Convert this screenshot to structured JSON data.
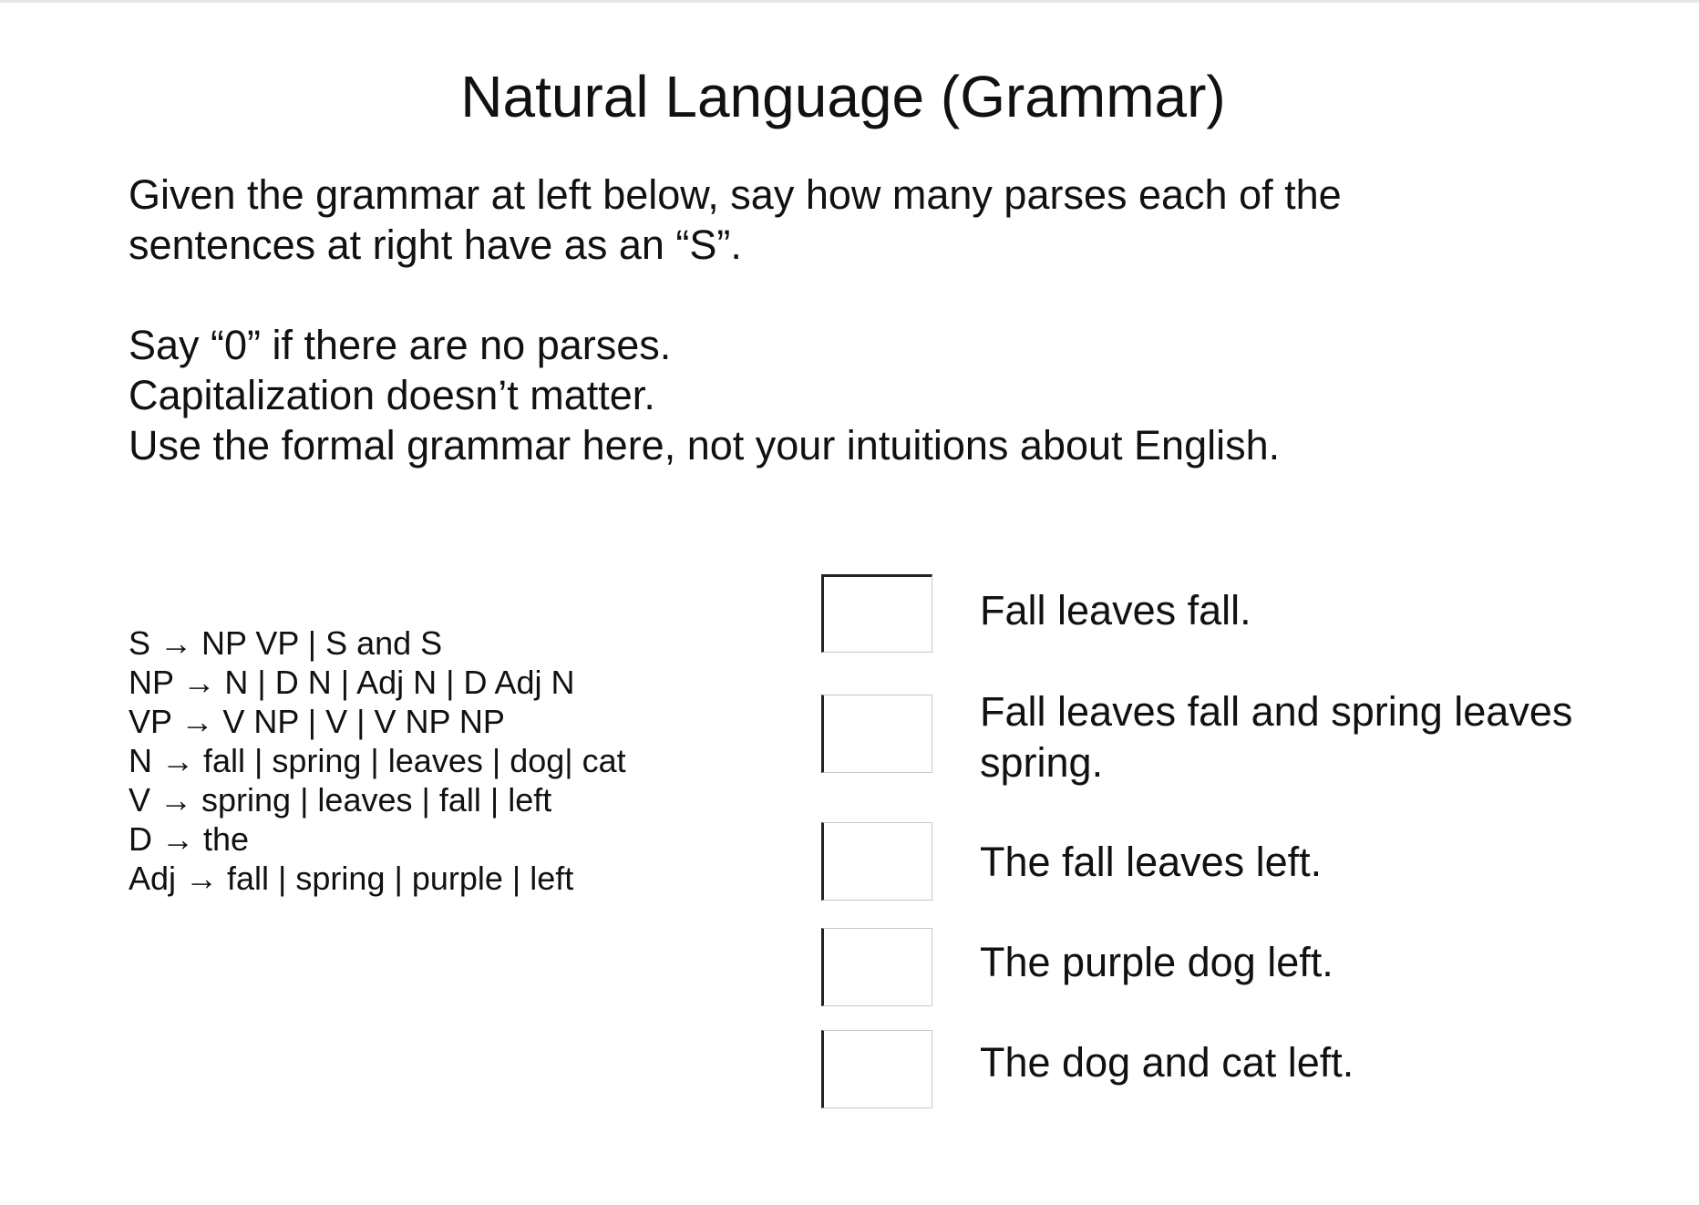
{
  "title": "Natural Language (Grammar)",
  "instructions": [
    "Given the grammar at left below, say how many parses each of the",
    "sentences at right have as an “S”.",
    "Say “0” if there are no parses.",
    "Capitalization doesn’t matter.",
    "Use the formal grammar here, not your intuitions about English."
  ],
  "grammar": [
    "S → NP VP | S and S",
    "NP → N | D N | Adj N | D Adj N",
    "VP → V NP | V | V NP NP",
    "N → fall | spring | leaves | dog| cat",
    "V → spring | leaves | fall | left",
    "D → the",
    "Adj → fall | spring | purple | left"
  ],
  "questions": [
    {
      "sentence": "Fall leaves fall.",
      "answer": ""
    },
    {
      "sentence": "Fall leaves fall and spring leaves spring.",
      "answer": ""
    },
    {
      "sentence": "The fall leaves left.",
      "answer": ""
    },
    {
      "sentence": "The purple dog left.",
      "answer": ""
    },
    {
      "sentence": "The dog and cat left.",
      "answer": ""
    }
  ]
}
